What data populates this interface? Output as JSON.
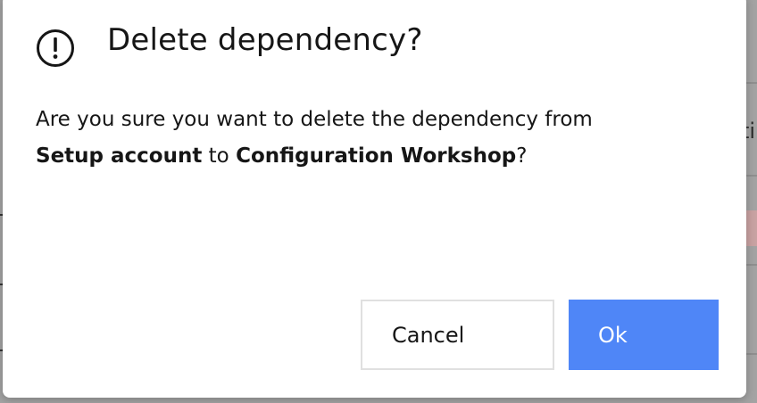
{
  "dialog": {
    "title": "Delete dependency?",
    "icon": "alert-circle-icon",
    "message": {
      "prefix": "Are you sure you want to delete the dependency from ",
      "source": "Setup account",
      "connector": " to ",
      "target": "Configuration Workshop",
      "suffix": "?"
    },
    "cancel_label": "Cancel",
    "ok_label": "Ok"
  },
  "background": {
    "partial_text": "ti"
  },
  "colors": {
    "primary": "#4f86f7",
    "text": "#161616",
    "overlay": "#a3a3a3"
  }
}
